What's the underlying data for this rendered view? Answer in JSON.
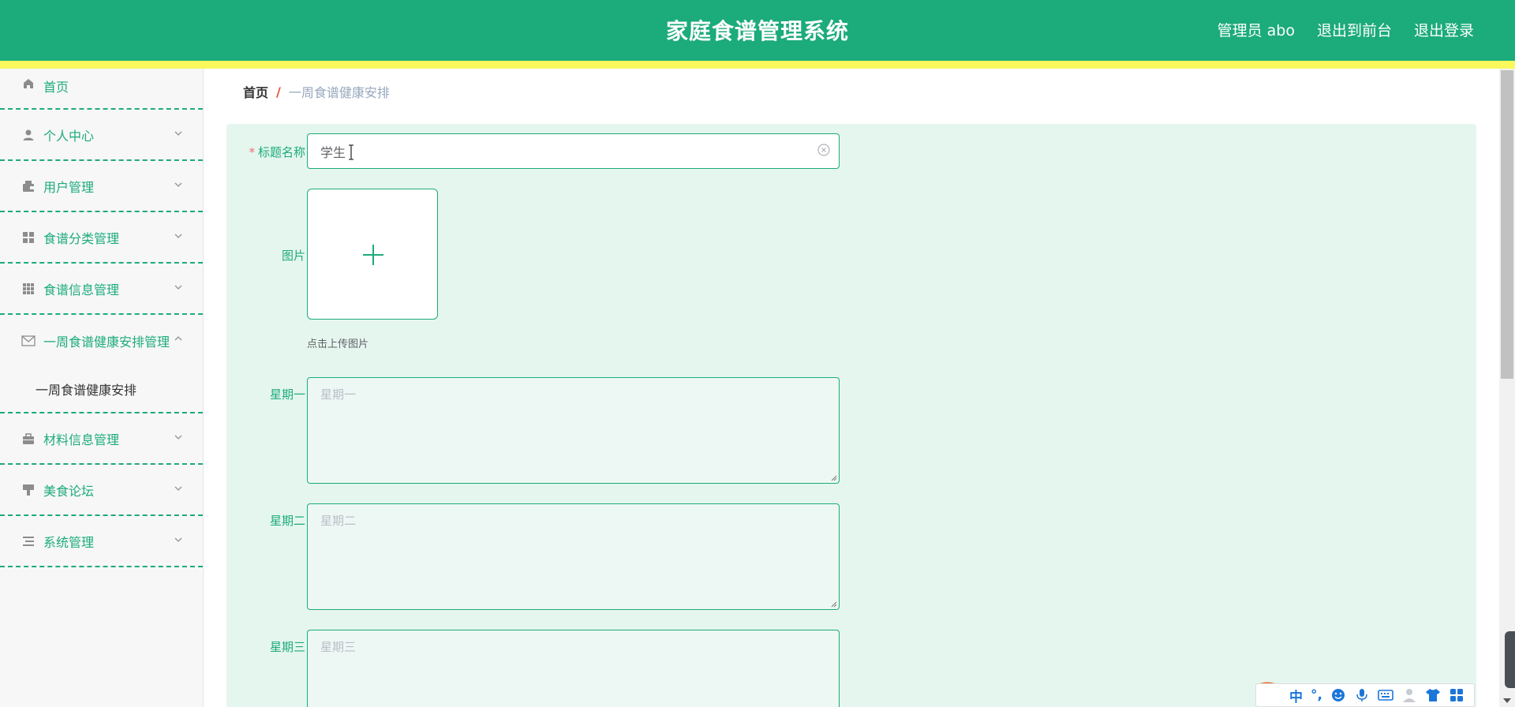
{
  "header": {
    "title": "家庭食谱管理系统",
    "admin_label": "管理员 abo",
    "exit_front_label": "退出到前台",
    "logout_label": "退出登录"
  },
  "sidebar": {
    "items": [
      {
        "label": "首页",
        "icon": "home-icon"
      },
      {
        "label": "个人中心",
        "icon": "user-icon"
      },
      {
        "label": "用户管理",
        "icon": "wallet-icon"
      },
      {
        "label": "食谱分类管理",
        "icon": "grid-icon"
      },
      {
        "label": "食谱信息管理",
        "icon": "grid-dots-icon"
      },
      {
        "label": "一周食谱健康安排管理",
        "icon": "mail-icon"
      },
      {
        "label": "材料信息管理",
        "icon": "briefcase-icon"
      },
      {
        "label": "美食论坛",
        "icon": "brush-icon"
      },
      {
        "label": "系统管理",
        "icon": "list-icon"
      }
    ],
    "submenu_item": "一周食谱健康安排"
  },
  "breadcrumb": {
    "home": "首页",
    "separator": "/",
    "current": "一周食谱健康安排"
  },
  "form": {
    "title_label": "标题名称",
    "title_value": "学生",
    "image_label": "图片",
    "upload_hint": "点击上传图片",
    "monday_label": "星期一",
    "monday_placeholder": "星期一",
    "tuesday_label": "星期二",
    "tuesday_placeholder": "星期二",
    "wednesday_label": "星期三",
    "wednesday_placeholder": "星期三"
  },
  "ime": {
    "chinese_label": "中",
    "punct_label": "°,"
  },
  "colors": {
    "primary": "#1cab7b",
    "stripe": "#f9f85d",
    "form_bg": "#e5f6ef"
  }
}
